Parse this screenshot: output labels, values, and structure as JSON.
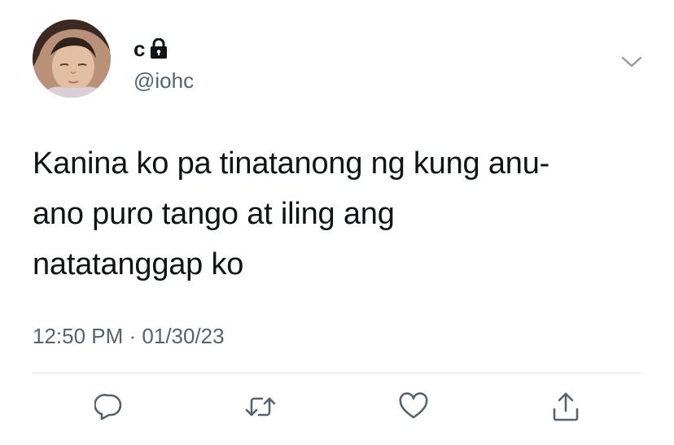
{
  "tweet": {
    "display_name": "c",
    "handle": "@iohc",
    "protected_icon": "lock-icon",
    "text_lines": [
      "Kanina ko pa tinatanong ng kung anu-",
      "ano puro tango at iling ang",
      "natatanggap ko"
    ],
    "timestamp": "12:50 PM · 01/30/23"
  },
  "actions": {
    "reply_icon": "comment-bubble-icon",
    "retweet_icon": "retweet-icon",
    "like_icon": "heart-icon",
    "share_icon": "share-upload-icon"
  },
  "colors": {
    "text_primary": "#0f1419",
    "text_secondary": "#536471",
    "icon": "#536471",
    "divider": "#dfe3e6"
  }
}
